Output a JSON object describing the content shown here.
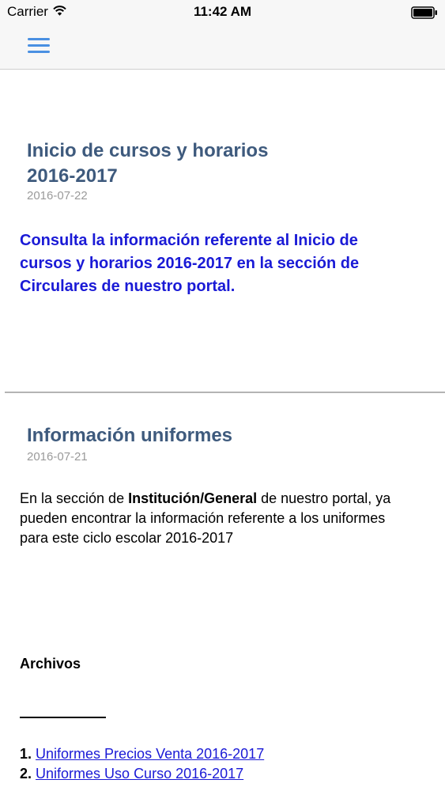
{
  "status_bar": {
    "carrier": "Carrier",
    "time": "11:42 AM",
    "wifi_icon": "wifi-icon",
    "battery_icon": "battery-icon"
  },
  "nav": {
    "menu_icon": "hamburger-menu-icon",
    "accent": "#4a90e2"
  },
  "posts": [
    {
      "title_line1": "Inicio de cursos y horarios",
      "title_line2": "2016-2017",
      "date": "2016-07-22",
      "body_line1": "Consulta la información referente al Inicio de",
      "body_line2": "cursos y horarios 2016-2017 en la sección de",
      "body_line3": "Circulares de nuestro portal."
    },
    {
      "title": "Información uniformes",
      "date": "2016-07-21",
      "body_prefix": "En la sección de ",
      "body_bold": "Institución/General",
      "body_suffix": " de nuestro portal, ya",
      "body_line2": "pueden encontrar la información referente a los uniformes",
      "body_line3": "para este ciclo escolar 2016-2017",
      "files_heading": "Archivos",
      "files": [
        {
          "num": "1.",
          "label": "Uniformes Precios Venta 2016-2017"
        },
        {
          "num": "2.",
          "label": "Uniformes Uso Curso 2016-2017"
        }
      ]
    }
  ],
  "colors": {
    "title": "#3e5a7d",
    "date": "#9a9a9a",
    "highlight_body": "#1a1ad6",
    "link": "#1a1ad6"
  }
}
